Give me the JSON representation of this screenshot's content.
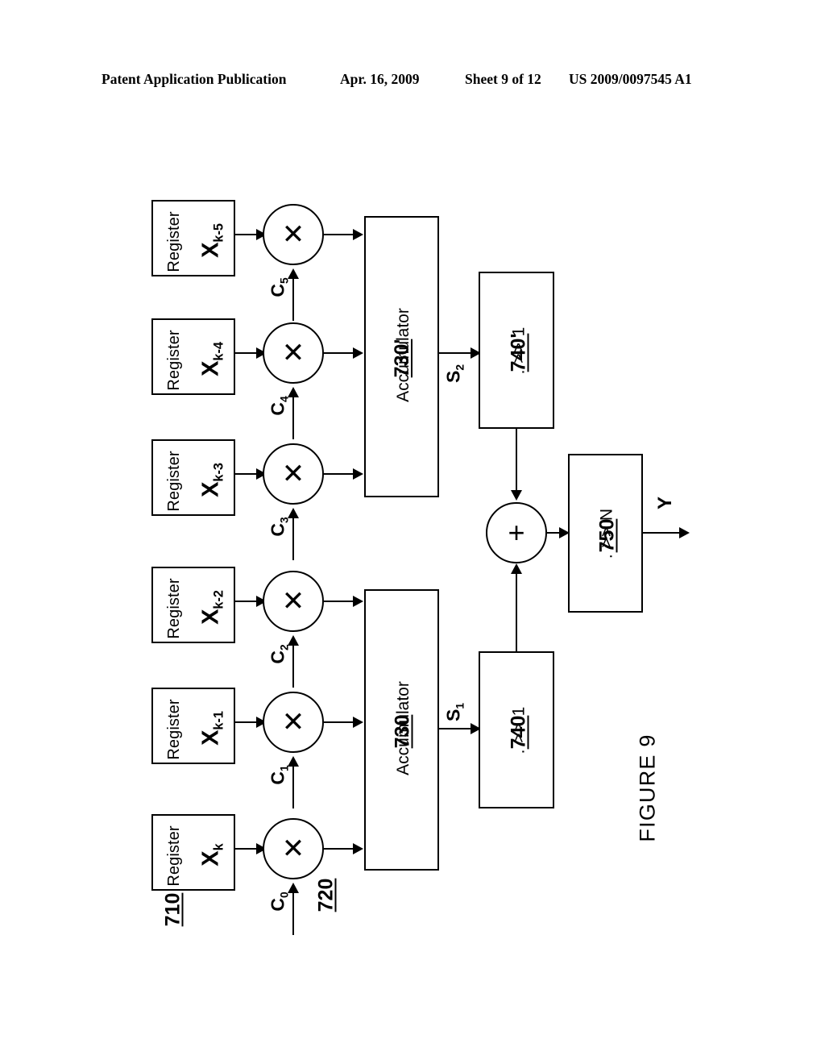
{
  "header": {
    "publication": "Patent Application Publication",
    "date": "Apr. 16, 2009",
    "sheet": "Sheet 9 of 12",
    "patent_number": "US 2009/0097545 A1"
  },
  "figure": {
    "caption": "FIGURE 9"
  },
  "registers": [
    {
      "label": "Register",
      "value": "X",
      "subscript": "k-5",
      "ref": ""
    },
    {
      "label": "Register",
      "value": "X",
      "subscript": "k-4",
      "ref": ""
    },
    {
      "label": "Register",
      "value": "X",
      "subscript": "k-3",
      "ref": ""
    },
    {
      "label": "Register",
      "value": "X",
      "subscript": "k-2",
      "ref": ""
    },
    {
      "label": "Register",
      "value": "X",
      "subscript": "k-1",
      "ref": ""
    },
    {
      "label": "Register",
      "value": "X",
      "subscript": "k",
      "ref": "710"
    }
  ],
  "multipliers": [
    {
      "glyph": "✕",
      "coefficient": "C",
      "subscript": "5",
      "ref": ""
    },
    {
      "glyph": "✕",
      "coefficient": "C",
      "subscript": "4",
      "ref": ""
    },
    {
      "glyph": "✕",
      "coefficient": "C",
      "subscript": "3",
      "ref": ""
    },
    {
      "glyph": "✕",
      "coefficient": "C",
      "subscript": "2",
      "ref": ""
    },
    {
      "glyph": "✕",
      "coefficient": "C",
      "subscript": "1",
      "ref": ""
    },
    {
      "glyph": "✕",
      "coefficient": "C",
      "subscript": "0",
      "ref": "720"
    }
  ],
  "accumulators": [
    {
      "label": "Accumulator",
      "ref": "730'",
      "output_signal": "S",
      "output_subscript": "2"
    },
    {
      "label": "Accumulator",
      "ref": "730",
      "output_signal": "S",
      "output_subscript": "1"
    }
  ],
  "shifters": [
    {
      "label": ". >> 1",
      "ref": "740'"
    },
    {
      "label": ". >> 1",
      "ref": "740"
    }
  ],
  "adder": {
    "glyph": "+"
  },
  "output_shifter": {
    "label": ". >> N",
    "ref": "750"
  },
  "output": {
    "label": "Y"
  }
}
